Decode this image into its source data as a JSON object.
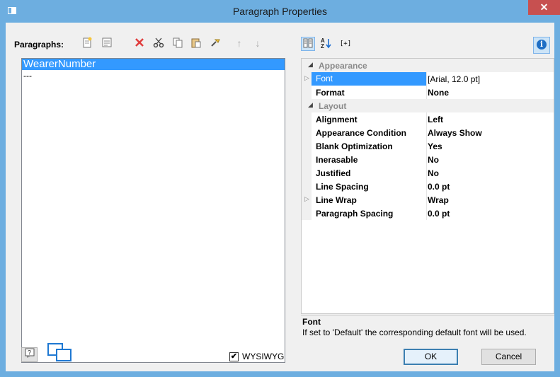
{
  "window": {
    "title": "Paragraph Properties",
    "close_glyph": "✕"
  },
  "left": {
    "paragraphs_label": "Paragraphs:",
    "toolbar_icons": [
      "new-paragraph-icon",
      "list-view-icon",
      "delete-icon",
      "cut-icon",
      "copy-icon",
      "paste-icon",
      "format-brush-icon",
      "move-up-icon",
      "move-down-icon"
    ],
    "items": [
      {
        "label": "WearerNumber",
        "selected": true
      },
      {
        "label": "---",
        "selected": false
      }
    ]
  },
  "right": {
    "toolbar_icons": [
      "categorized-view-icon",
      "sort-alpha-icon",
      "expand-all-icon",
      "info-icon"
    ],
    "categories": [
      {
        "label": "Appearance",
        "rows": [
          {
            "name": "Font",
            "value": "[Arial, 12.0 pt]",
            "expandable": true,
            "selected": true
          },
          {
            "name": "Format",
            "value": "None",
            "expandable": false,
            "selected": false
          }
        ]
      },
      {
        "label": "Layout",
        "rows": [
          {
            "name": "Alignment",
            "value": "Left",
            "expandable": false,
            "selected": false
          },
          {
            "name": "Appearance Condition",
            "value": "Always Show",
            "expandable": false,
            "selected": false
          },
          {
            "name": "Blank Optimization",
            "value": "Yes",
            "expandable": false,
            "selected": false
          },
          {
            "name": "Inerasable",
            "value": "No",
            "expandable": false,
            "selected": false
          },
          {
            "name": "Justified",
            "value": "No",
            "expandable": false,
            "selected": false
          },
          {
            "name": "Line Spacing",
            "value": "0.0 pt",
            "expandable": false,
            "selected": false
          },
          {
            "name": "Line Wrap",
            "value": "Wrap",
            "expandable": true,
            "selected": false
          },
          {
            "name": "Paragraph Spacing",
            "value": "0.0 pt",
            "expandable": false,
            "selected": false
          }
        ]
      }
    ],
    "description": {
      "title": "Font",
      "text": "If set to 'Default' the corresponding default font will be used."
    }
  },
  "footer": {
    "wysiwyg_label": "WYSIWYG",
    "wysiwyg_checked": true,
    "ok_label": "OK",
    "cancel_label": "Cancel"
  },
  "colors": {
    "titlebar": "#6daee0",
    "selection": "#3399ff",
    "close": "#c75050",
    "delete_icon": "#e03c3c"
  }
}
